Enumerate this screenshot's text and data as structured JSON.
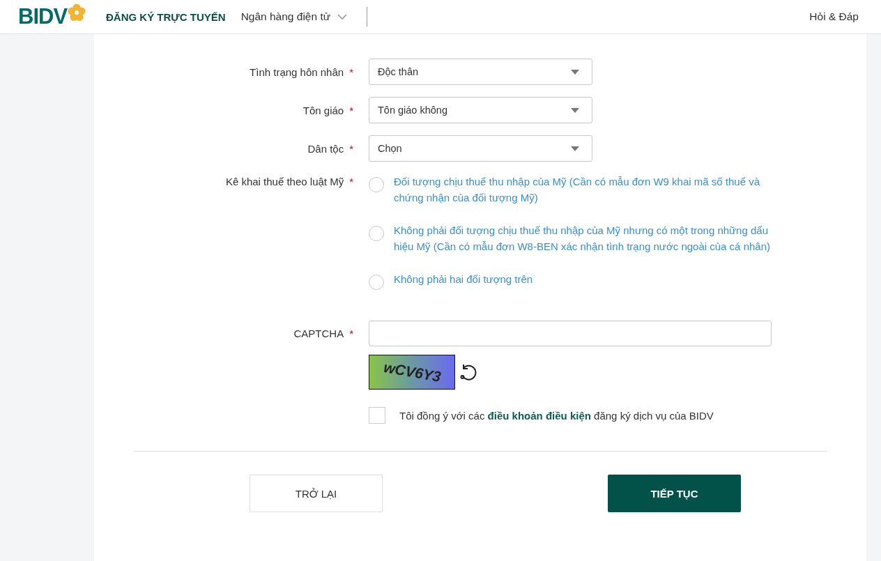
{
  "header": {
    "logo": "BIDV",
    "title": "ĐĂNG KÝ TRỰC TUYẾN",
    "menu": "Ngân hàng điện tử",
    "help": "Hỏi & Đáp"
  },
  "fields": [
    {
      "label": "Tình trạng hôn nhân",
      "required_mark": "*",
      "value": "Độc thân"
    },
    {
      "label": "Tôn giáo",
      "required_mark": "*",
      "value": "Tôn giáo không"
    },
    {
      "label": "Dân tộc",
      "required_mark": "*",
      "value": "Chọn"
    }
  ],
  "tax": {
    "label": "Kê khai thuế theo luật Mỹ",
    "required_mark": "*",
    "options": [
      {
        "text": "Đối tượng chịu thuế thu nhập của Mỹ (Cần có mẫu đơn W9 khai mã số thuế và chứng nhận của đối tượng Mỹ)",
        "selected": false
      },
      {
        "text": "Không phải đối tượng chịu thuế thu nhập của Mỹ nhưng có một trong những dấu hiệu Mỹ (Cần có mẫu đơn W8-BEN xác nhận tình trạng nước ngoài của cá nhân)",
        "selected": false
      },
      {
        "text": "Không phải hai đối tượng trên",
        "selected": false
      }
    ]
  },
  "captcha": {
    "label": "CAPTCHA",
    "required_mark": "*",
    "image_text": "wCV6Y3"
  },
  "agreement": {
    "checked": false,
    "before": "Tôi đồng ý với các",
    "link": "điều khoản điều kiện",
    "after": "đăng ký dịch vụ của BIDV"
  },
  "buttons": [
    {
      "label": "TRỞ LẠI",
      "kind": "secondary"
    },
    {
      "label": "TIẾP TỤC",
      "kind": "primary"
    }
  ]
}
